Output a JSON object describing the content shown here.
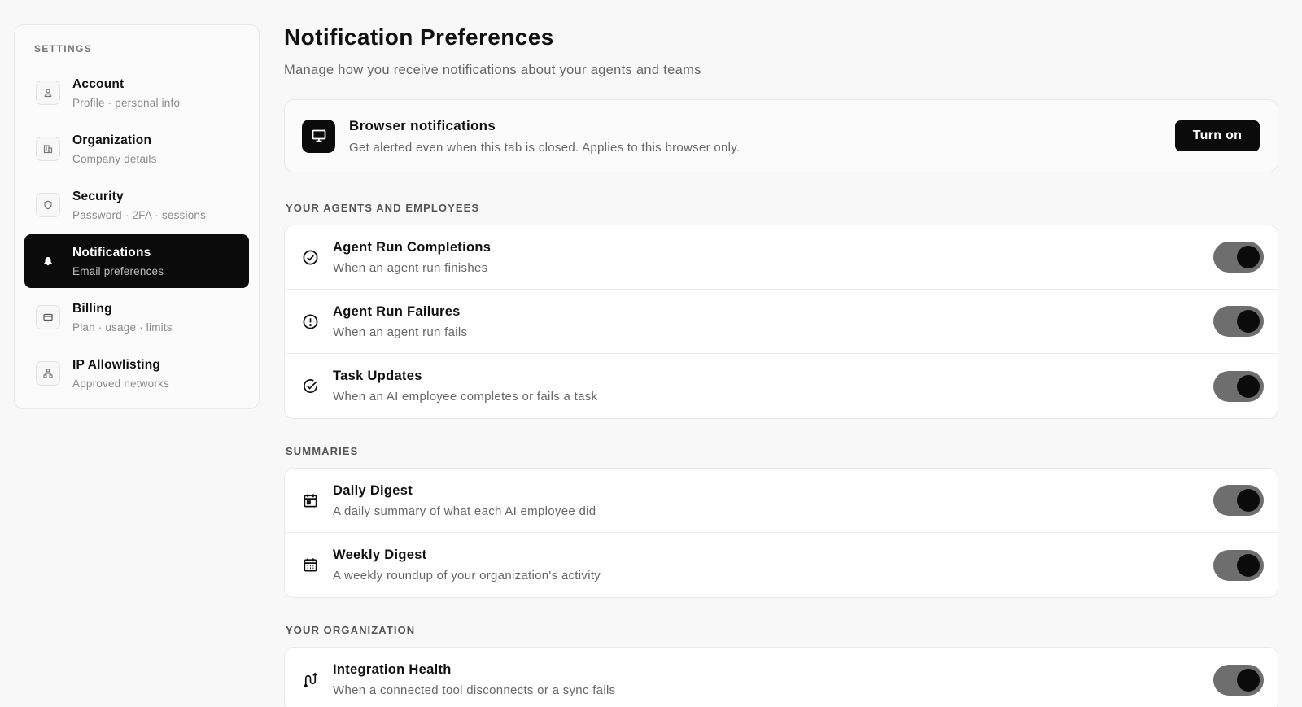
{
  "sidebar": {
    "heading": "SETTINGS",
    "items": [
      {
        "label": "Account",
        "sub": "Profile · personal info",
        "icon": "user-icon",
        "active": false
      },
      {
        "label": "Organization",
        "sub": "Company details",
        "icon": "building-icon",
        "active": false
      },
      {
        "label": "Security",
        "sub": "Password · 2FA · sessions",
        "icon": "shield-icon",
        "active": false
      },
      {
        "label": "Notifications",
        "sub": "Email preferences",
        "icon": "bell-icon",
        "active": true
      },
      {
        "label": "Billing",
        "sub": "Plan · usage · limits",
        "icon": "credit-card-icon",
        "active": false
      },
      {
        "label": "IP Allowlisting",
        "sub": "Approved networks",
        "icon": "network-icon",
        "active": false
      }
    ]
  },
  "main": {
    "title": "Notification Preferences",
    "subtitle": "Manage how you receive notifications about your agents and teams",
    "browser": {
      "title": "Browser notifications",
      "desc": "Get alerted even when this tab is closed. Applies to this browser only.",
      "button": "Turn on",
      "icon": "monitor-icon"
    },
    "sections": [
      {
        "heading": "YOUR AGENTS AND EMPLOYEES",
        "rows": [
          {
            "title": "Agent Run Completions",
            "desc": "When an agent run finishes",
            "icon": "check-circle-icon",
            "enabled": true
          },
          {
            "title": "Agent Run Failures",
            "desc": "When an agent run fails",
            "icon": "alert-circle-icon",
            "enabled": true
          },
          {
            "title": "Task Updates",
            "desc": "When an AI employee completes or fails a task",
            "icon": "check-circle-icon",
            "enabled": true
          }
        ]
      },
      {
        "heading": "SUMMARIES",
        "rows": [
          {
            "title": "Daily Digest",
            "desc": "A daily summary of what each AI employee did",
            "icon": "calendar-day-icon",
            "enabled": true
          },
          {
            "title": "Weekly Digest",
            "desc": "A weekly roundup of your organization's activity",
            "icon": "calendar-week-icon",
            "enabled": true
          }
        ]
      },
      {
        "heading": "YOUR ORGANIZATION",
        "rows": [
          {
            "title": "Integration Health",
            "desc": "When a connected tool disconnects or a sync fails",
            "icon": "route-icon",
            "enabled": true
          }
        ]
      }
    ]
  }
}
